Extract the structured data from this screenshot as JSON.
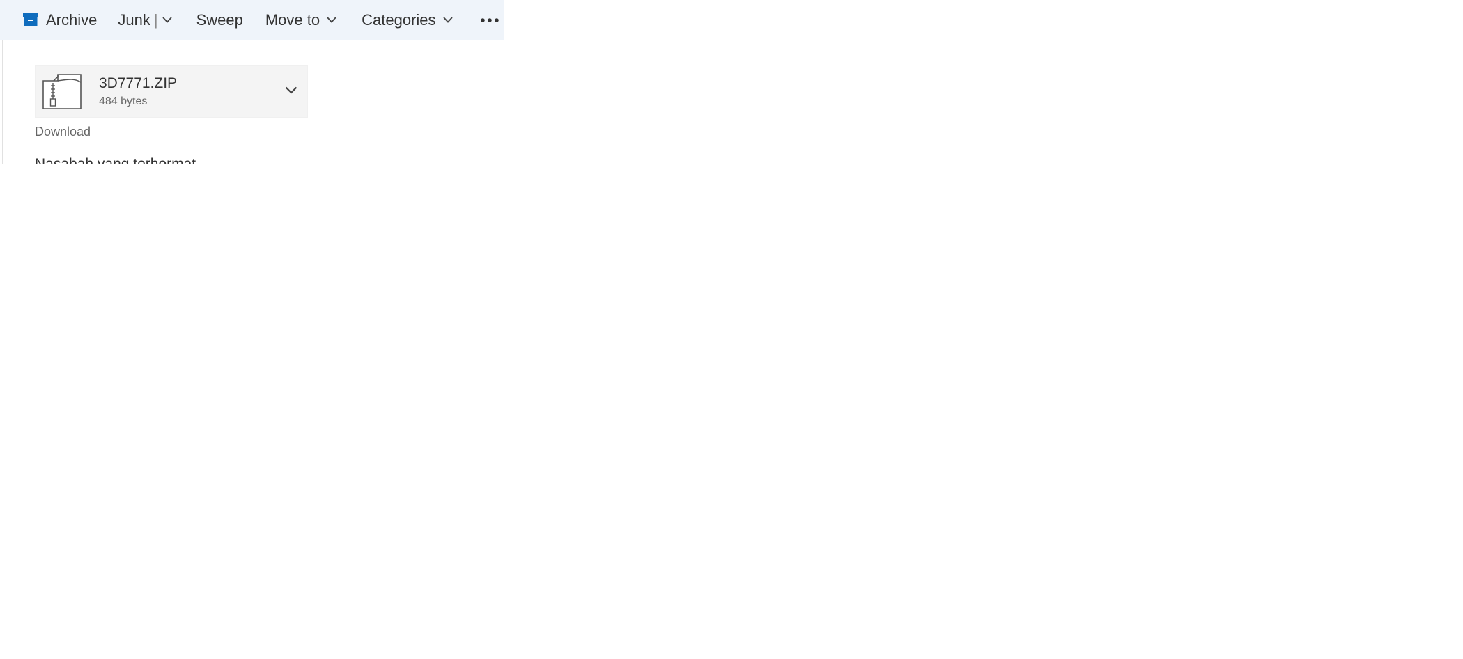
{
  "toolbar": {
    "archive_label": "Archive",
    "junk_label": "Junk",
    "junk_separator": "|",
    "sweep_label": "Sweep",
    "move_to_label": "Move to",
    "categories_label": "Categories",
    "more_icon": "more-horizontal-icon",
    "accent_color": "#0f6cbd",
    "background_color": "#eff4fa"
  },
  "attachment": {
    "file_name": "3D7771.ZIP",
    "file_size": "484 bytes",
    "icon": "zip-file-icon",
    "expand_icon": "chevron-down-icon"
  },
  "download_label": "Download",
  "message": {
    "greeting_line": "Nasabah yang terhormat"
  }
}
